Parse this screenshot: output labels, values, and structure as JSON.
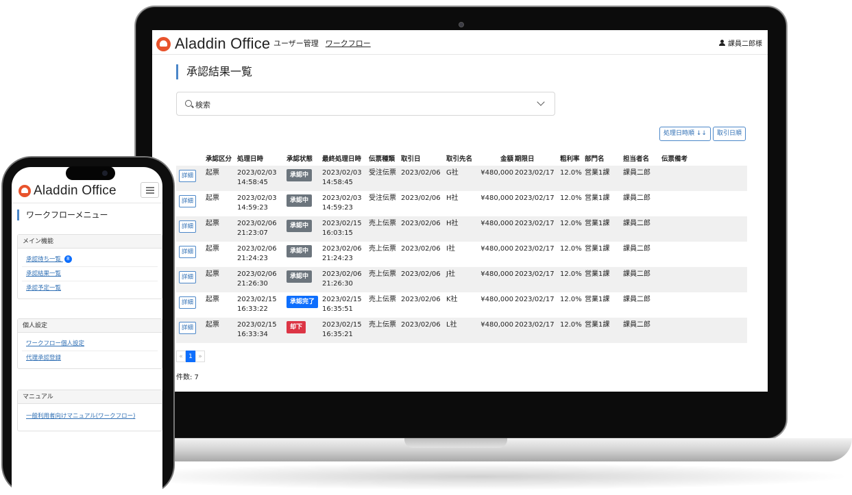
{
  "laptop": {
    "header": {
      "logo_text": "Aladdin Office",
      "nav": [
        "ユーザー管理",
        "ワークフロー"
      ],
      "user_name": "課員二郎様"
    },
    "page_title": "承認結果一覧",
    "search_label": "検索",
    "sort_buttons": [
      "処理日時順 ↓↓",
      "取引日順"
    ],
    "table": {
      "headers": [
        "",
        "承認区分",
        "処理日時",
        "承認状態",
        "最終処理日時",
        "伝票種類",
        "取引日",
        "取引先名",
        "金額",
        "期限日",
        "粗利率",
        "部門名",
        "担当者名",
        "伝票備考"
      ],
      "rows": [
        {
          "detail": "詳細",
          "kubun": "起票",
          "date1": "2023/02/03",
          "time1": "14:58:45",
          "status": "承認中",
          "date2": "2023/02/03",
          "time2": "14:58:45",
          "type": "受注伝票",
          "trade": "2023/02/06",
          "client": "G社",
          "amount": "¥480,000",
          "due": "2023/02/17",
          "margin": "12.0%",
          "dept": "営業1課",
          "person": "課員二郎",
          "note": ""
        },
        {
          "detail": "詳細",
          "kubun": "起票",
          "date1": "2023/02/03",
          "time1": "14:59:23",
          "status": "承認中",
          "date2": "2023/02/03",
          "time2": "14:59:23",
          "type": "受注伝票",
          "trade": "2023/02/06",
          "client": "H社",
          "amount": "¥480,000",
          "due": "2023/02/17",
          "margin": "12.0%",
          "dept": "営業1課",
          "person": "課員二郎",
          "note": ""
        },
        {
          "detail": "詳細",
          "kubun": "起票",
          "date1": "2023/02/06",
          "time1": "21:23:07",
          "status": "承認中",
          "date2": "2023/02/15",
          "time2": "16:03:15",
          "type": "売上伝票",
          "trade": "2023/02/06",
          "client": "H社",
          "amount": "¥480,000",
          "due": "2023/02/17",
          "margin": "12.0%",
          "dept": "営業1課",
          "person": "課員二郎",
          "note": ""
        },
        {
          "detail": "詳細",
          "kubun": "起票",
          "date1": "2023/02/06",
          "time1": "21:24:23",
          "status": "承認中",
          "date2": "2023/02/06",
          "time2": "21:24:23",
          "type": "売上伝票",
          "trade": "2023/02/06",
          "client": "I社",
          "amount": "¥480,000",
          "due": "2023/02/17",
          "margin": "12.0%",
          "dept": "営業1課",
          "person": "課員二郎",
          "note": ""
        },
        {
          "detail": "詳細",
          "kubun": "起票",
          "date1": "2023/02/06",
          "time1": "21:26:30",
          "status": "承認中",
          "date2": "2023/02/06",
          "time2": "21:26:30",
          "type": "売上伝票",
          "trade": "2023/02/06",
          "client": "J社",
          "amount": "¥480,000",
          "due": "2023/02/17",
          "margin": "12.0%",
          "dept": "営業1課",
          "person": "課員二郎",
          "note": ""
        },
        {
          "detail": "詳細",
          "kubun": "起票",
          "date1": "2023/02/15",
          "time1": "16:33:22",
          "status": "承認完了",
          "date2": "2023/02/15",
          "time2": "16:35:51",
          "type": "売上伝票",
          "trade": "2023/02/06",
          "client": "K社",
          "amount": "¥480,000",
          "due": "2023/02/17",
          "margin": "12.0%",
          "dept": "営業1課",
          "person": "課員二郎",
          "note": ""
        },
        {
          "detail": "詳細",
          "kubun": "起票",
          "date1": "2023/02/15",
          "time1": "16:33:34",
          "status": "却下",
          "date2": "2023/02/15",
          "time2": "16:35:21",
          "type": "売上伝票",
          "trade": "2023/02/06",
          "client": "L社",
          "amount": "¥480,000",
          "due": "2023/02/17",
          "margin": "12.0%",
          "dept": "営業1課",
          "person": "課員二郎",
          "note": ""
        }
      ]
    },
    "pager": {
      "prev": "«",
      "current": "1",
      "next": "»"
    },
    "count": "件数: 7"
  },
  "phone": {
    "logo_text": "Aladdin Office",
    "page_title": "ワークフローメニュー",
    "sections": [
      {
        "title": "メイン機能",
        "items": [
          "承認待ち一覧",
          "承認結果一覧",
          "承認予定一覧"
        ],
        "badge": "8"
      },
      {
        "title": "個人設定",
        "items": [
          "ワークフロー個人設定",
          "代理承認登録"
        ]
      },
      {
        "title": "マニュアル",
        "items": [
          "一般利用者向けマニュアル(ワークフロー)"
        ]
      }
    ]
  },
  "colors": {
    "brand": "#e8532c",
    "accent": "#4a86c8",
    "status_pending": "#6c757d",
    "status_done": "#0d6efd",
    "status_rejected": "#dc3545"
  }
}
